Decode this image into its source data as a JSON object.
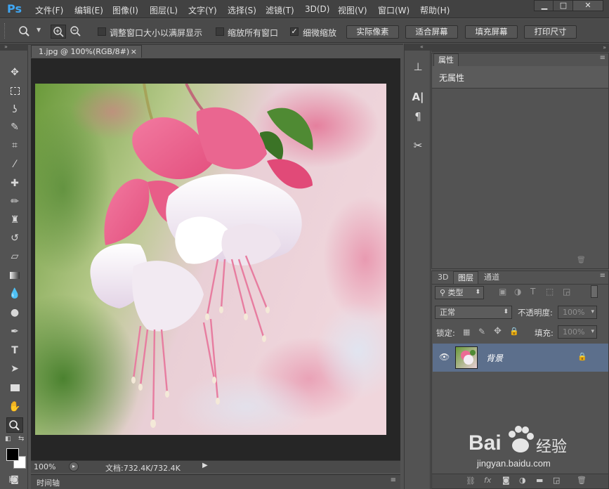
{
  "app": {
    "logo": "Ps"
  },
  "menu": [
    {
      "label": "文件(F)"
    },
    {
      "label": "编辑(E)"
    },
    {
      "label": "图像(I)"
    },
    {
      "label": "图层(L)"
    },
    {
      "label": "文字(Y)"
    },
    {
      "label": "选择(S)"
    },
    {
      "label": "滤镜(T)"
    },
    {
      "label": "3D(D)"
    },
    {
      "label": "视图(V)"
    },
    {
      "label": "窗口(W)"
    },
    {
      "label": "帮助(H)"
    }
  ],
  "window_controls": {
    "minimize": "▁",
    "maximize": "□",
    "close": "✕"
  },
  "options": {
    "resize_windows_label": "调整窗口大小以满屏显示",
    "resize_windows_checked": false,
    "zoom_all_label": "缩放所有窗口",
    "zoom_all_checked": false,
    "scrubby_zoom_label": "细微缩放",
    "scrubby_zoom_checked": true,
    "actual_pixels": "实际像素",
    "fit_screen": "适合屏幕",
    "fill_screen": "填充屏幕",
    "print_size": "打印尺寸"
  },
  "document": {
    "tab_title": "1.jpg @ 100%(RGB/8#)",
    "tab_close": "×",
    "zoom": "100%",
    "doc_info": "文档:732.4K/732.4K"
  },
  "timeline": {
    "label": "时间轴"
  },
  "properties": {
    "tab": "属性",
    "content": "无属性"
  },
  "layers": {
    "tabs": [
      "3D",
      "图层",
      "通道"
    ],
    "filter_label": "类型",
    "blend_mode": "正常",
    "opacity_label": "不透明度:",
    "opacity_value": "100%",
    "lock_label": "锁定:",
    "fill_label": "填充:",
    "fill_value": "100%",
    "items": [
      {
        "name": "背景",
        "locked": true,
        "visible": true
      }
    ]
  },
  "watermark": {
    "brand": "Bai",
    "brand2": "经验",
    "url": "jingyan.baidu.com"
  },
  "colors": {
    "accent": "#3fa7f4",
    "selected_layer": "#5c6f8c",
    "foreground": "#000000",
    "background": "#ffffff"
  }
}
